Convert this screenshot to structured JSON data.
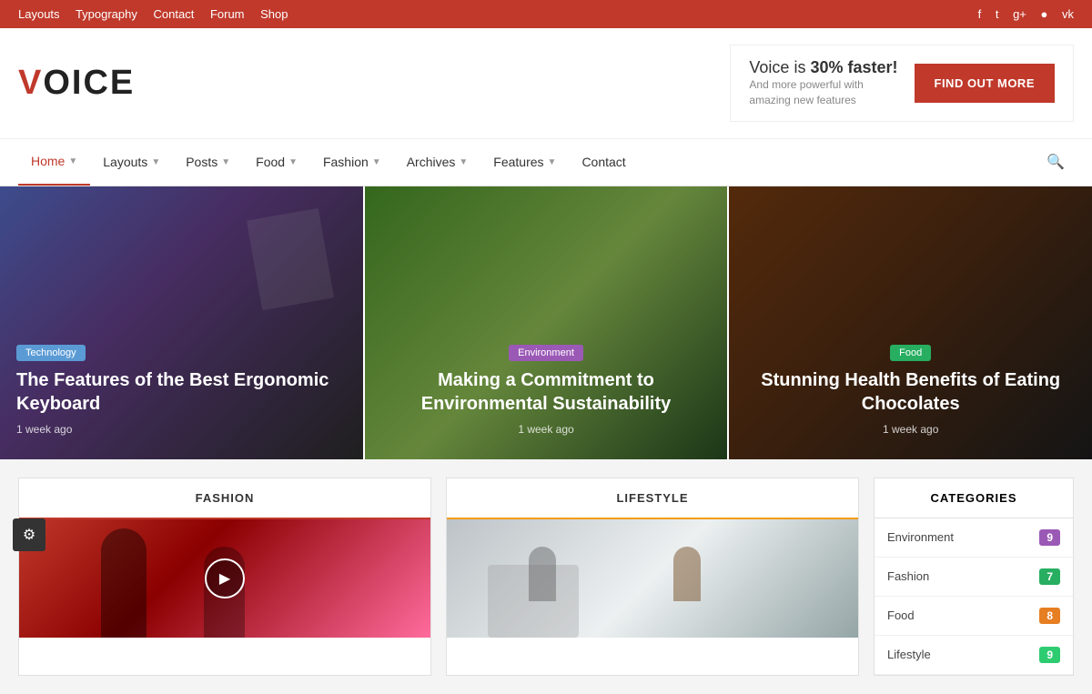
{
  "topbar": {
    "nav": [
      "Layouts",
      "Typography",
      "Contact",
      "Forum",
      "Shop"
    ],
    "social": [
      "f",
      "t",
      "g+",
      "ig",
      "vk"
    ]
  },
  "header": {
    "logo": "VOICE",
    "ad": {
      "text": "Voice is ",
      "highlight": "30% faster!",
      "sub": "And more powerful with amazing new features",
      "btn": "FIND OUT MORE"
    }
  },
  "nav": {
    "items": [
      {
        "label": "Home",
        "active": true
      },
      {
        "label": "Layouts"
      },
      {
        "label": "Posts"
      },
      {
        "label": "Food"
      },
      {
        "label": "Fashion"
      },
      {
        "label": "Archives"
      },
      {
        "label": "Features"
      },
      {
        "label": "Contact"
      }
    ]
  },
  "hero": {
    "slides": [
      {
        "badge": "Technology",
        "badge_class": "badge-tech",
        "title": "The Features of the Best Ergonomic Keyboard",
        "time": "1 week ago",
        "slide_class": "slide-1"
      },
      {
        "badge": "Environment",
        "badge_class": "badge-env",
        "title": "Making a Commitment to Environmental Sustainability",
        "time": "1 week ago",
        "slide_class": "slide-2"
      },
      {
        "badge": "Food",
        "badge_class": "badge-food",
        "title": "Stunning Health Benefits of Eating Chocolates",
        "time": "1 week ago",
        "slide_class": "slide-3"
      }
    ]
  },
  "sections": {
    "fashion": {
      "label": "FASHION"
    },
    "lifestyle": {
      "label": "LIFESTYLE"
    }
  },
  "categories": {
    "title": "CATEGORIES",
    "items": [
      {
        "label": "Environment",
        "count": "9",
        "color_class": "cat-purple"
      },
      {
        "label": "Fashion",
        "count": "7",
        "color_class": "cat-green"
      },
      {
        "label": "Food",
        "count": "8",
        "color_class": "cat-orange"
      },
      {
        "label": "Lifestyle",
        "count": "9",
        "color_class": "cat-lime"
      }
    ]
  }
}
